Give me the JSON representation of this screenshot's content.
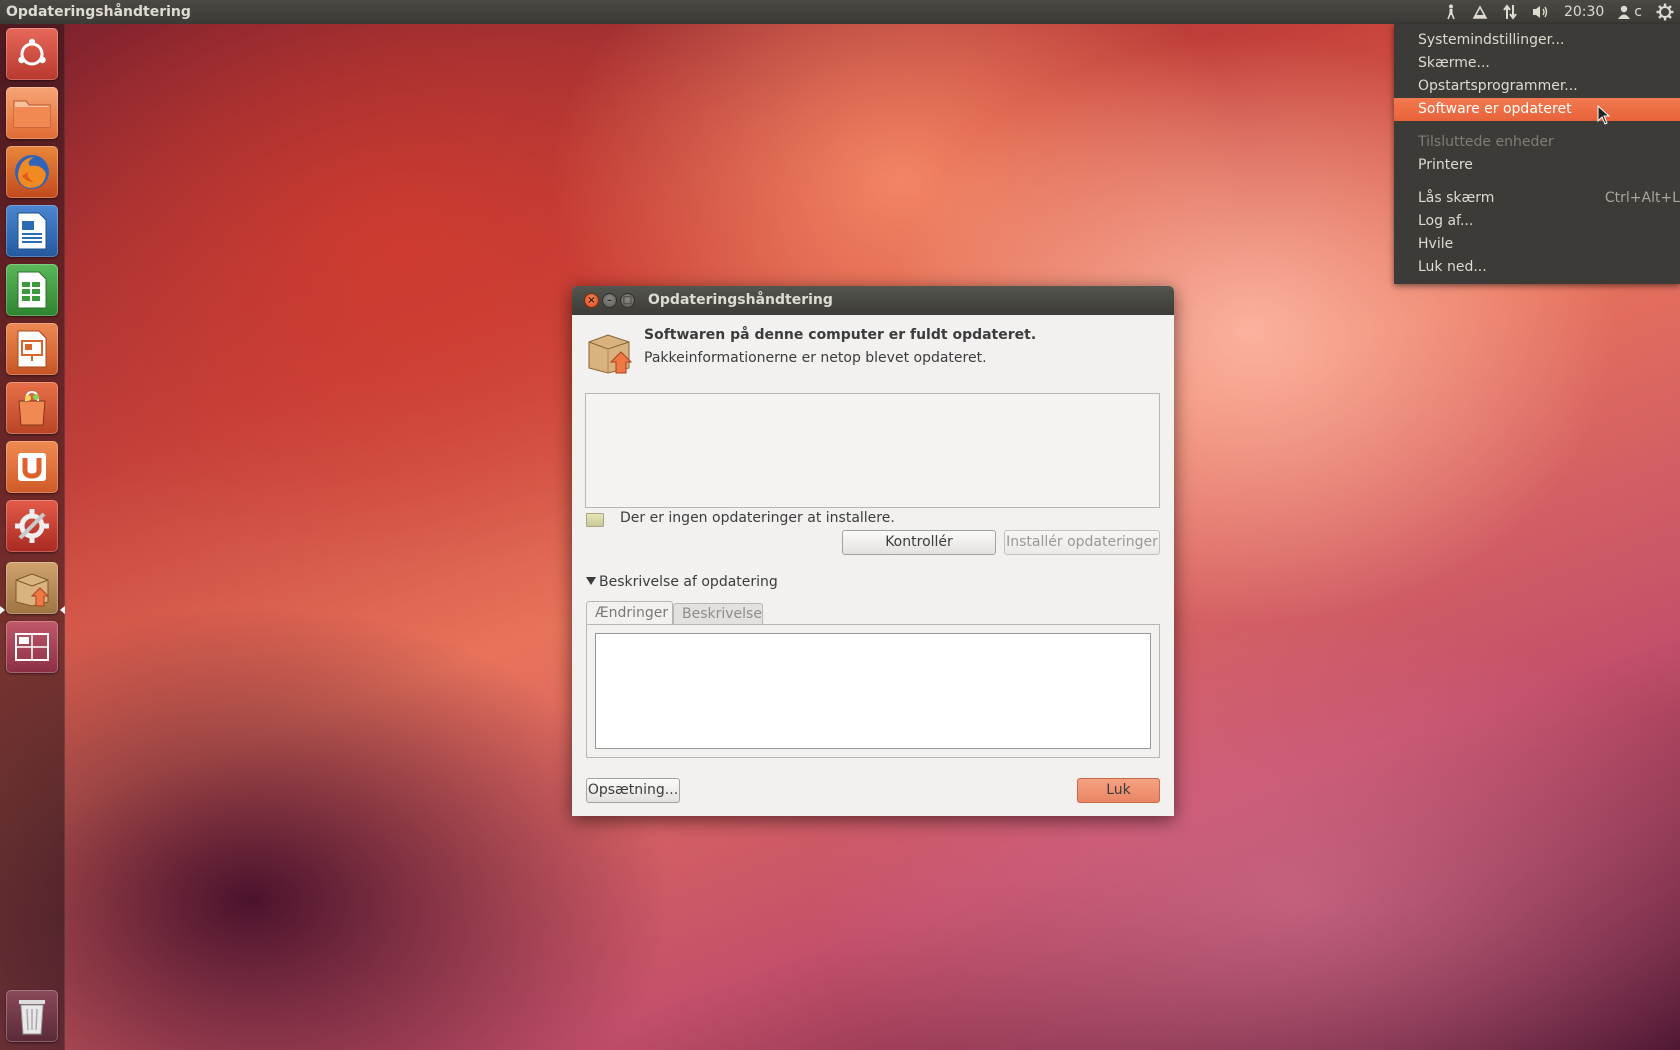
{
  "top_panel": {
    "app_title": "Opdateringshåndtering",
    "clock": "20:30",
    "user": "c",
    "icons": [
      "accessibility-icon",
      "keyboard-icon",
      "network-icon",
      "volume-icon",
      "user-icon",
      "gear-icon"
    ]
  },
  "launcher": {
    "items": [
      "dash-home",
      "files",
      "firefox",
      "writer",
      "calc",
      "impress",
      "software-center",
      "ubuntu-one",
      "system-settings",
      "update-manager",
      "workspace-switcher",
      "trash"
    ],
    "colors": {
      "orange": "#f07746",
      "firefox": "#e7572a",
      "writer": "#2c6ab4",
      "calc": "#3b9a3c",
      "impress": "#d9652c"
    }
  },
  "menu": {
    "items": [
      {
        "label": "Systemindstillinger...",
        "state": "normal",
        "accel": ""
      },
      {
        "label": "Skærme...",
        "state": "normal",
        "accel": ""
      },
      {
        "label": "Opstartsprogrammer...",
        "state": "normal",
        "accel": ""
      },
      {
        "label": "Software er opdateret",
        "state": "highlighted",
        "accel": ""
      },
      {
        "label": "Tilsluttede enheder",
        "state": "disabled",
        "accel": ""
      },
      {
        "label": "Printere",
        "state": "normal",
        "accel": ""
      },
      {
        "label": "Lås skærm",
        "state": "normal",
        "accel": "Ctrl+Alt+L"
      },
      {
        "label": "Log af...",
        "state": "normal",
        "accel": ""
      },
      {
        "label": "Hvile",
        "state": "normal",
        "accel": ""
      },
      {
        "label": "Luk ned...",
        "state": "normal",
        "accel": ""
      }
    ],
    "highlight_color": "#f07746"
  },
  "dialog": {
    "title": "Opdateringshåndtering",
    "window_buttons": {
      "close": "×",
      "minimize": "–",
      "maximize": "□"
    },
    "headline": "Softwaren på denne computer er fuldt opdateret.",
    "subline": "Pakkeinformationerne er netop blevet opdateret.",
    "status": "Der er ingen opdateringer at installere.",
    "check_button": "Kontrollér",
    "install_button": "Installér opdateringer",
    "expander_label": "Beskrivelse af opdatering",
    "tabs": [
      {
        "label": "Ændringer",
        "active": true
      },
      {
        "label": "Beskrivelse",
        "active": false
      }
    ],
    "settings_button": "Opsætning...",
    "close_button": "Luk"
  }
}
